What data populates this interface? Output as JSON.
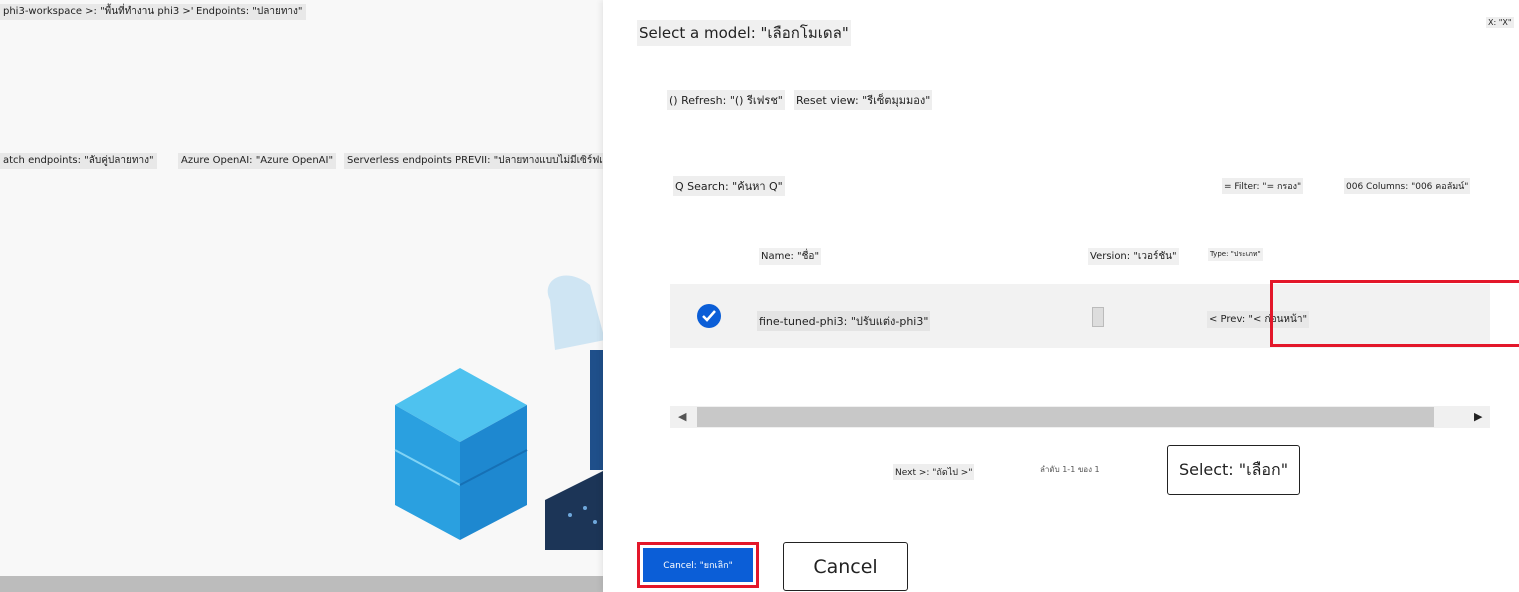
{
  "background": {
    "breadcrumb_workspace": "phi3-workspace >: \"พื้นที่ทำงาน phi3 >\"",
    "breadcrumb_endpoints": "Endpoints: \"ปลายทาง\"",
    "tabs": [
      "atch endpoints: \"ลับคู่ปลายทาง\"",
      "Azure OpenAI: \"Azure OpenAI\"",
      "Serverless endpoints PREVII: \"ปลายทางแบบไม่มีเซิร์ฟเวอร์ PREVII\""
    ]
  },
  "dialog": {
    "title": "Select a model: \"เลือกโมเดล\"",
    "close_label": "X: \"X\"",
    "toolbar": {
      "refresh": "() Refresh: \"() รีเฟรช\"",
      "reset_view": "Reset view: \"รีเซ็ตมุมมอง\""
    },
    "search": "Q Search: \"ค้นหา Q\"",
    "filter": "= Filter: \"= กรอง\"",
    "columns": "006 Columns: \"006 คอลัมน์\"",
    "table": {
      "headers": [
        "Name: \"ชื่อ\"",
        "Version: \"เวอร์ชัน\"",
        "Type: \"ประเภท\""
      ],
      "rows": [
        {
          "name": "fine-tuned-phi3: \"ปรับแต่ง-phi3\"",
          "prev": "< Prev: \"< ก่อนหน้า\"",
          "selected": true
        }
      ]
    },
    "pagination": {
      "next": "Next >: \"ถัดไป >\"",
      "info": "ลำดับ 1-1 ของ 1"
    },
    "select_button": "Select: \"เลือก\"",
    "cancel_primary": "Cancel: \"ยกเลิก\"",
    "cancel_button": "Cancel"
  },
  "colors": {
    "accent": "#0b5ed7",
    "highlight": "#e3172a"
  }
}
